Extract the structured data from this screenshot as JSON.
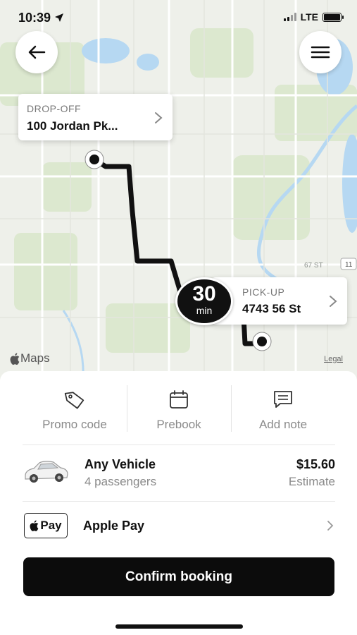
{
  "status_bar": {
    "time": "10:39",
    "network": "LTE",
    "icons": [
      "location-arrow-icon",
      "signal-icon",
      "battery-icon"
    ]
  },
  "map": {
    "dropoff": {
      "label": "DROP-OFF",
      "address": "100 Jordan Pk..."
    },
    "pickup": {
      "label": "PICK-UP",
      "address": "4743 56 St"
    },
    "eta": {
      "value": "30",
      "unit": "min"
    },
    "road_labels": [
      "67 ST",
      "11"
    ],
    "branding": "Maps",
    "legal": "Legal"
  },
  "actions": [
    {
      "label": "Promo code",
      "icon": "tag-icon"
    },
    {
      "label": "Prebook",
      "icon": "calendar-icon"
    },
    {
      "label": "Add note",
      "icon": "note-icon"
    }
  ],
  "vehicle": {
    "name": "Any Vehicle",
    "passengers": "4 passengers",
    "price": "$15.60",
    "price_note": "Estimate"
  },
  "payment": {
    "badge": "Pay",
    "method": "Apple Pay"
  },
  "confirm_label": "Confirm booking",
  "colors": {
    "accent": "#0c0c0c",
    "map_bg": "#eef0ea",
    "water": "#b6d8f2",
    "park": "#dce8cf"
  }
}
